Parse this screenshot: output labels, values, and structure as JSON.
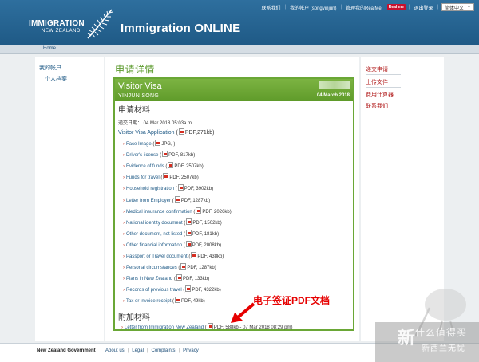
{
  "header": {
    "logo_line1": "IMMIGRATION",
    "logo_line2": "NEW ZEALAND",
    "app_title": "Immigration ONLINE",
    "links": [
      "联系我们",
      "我的帐户 (songyinjun)",
      "管理我的RealMe",
      "退出登录"
    ],
    "realme_badge": "Real me",
    "language": "简体中文"
  },
  "nav": {
    "home": "Home"
  },
  "left_nav": {
    "my_account": "我的帐户",
    "profile": "个人档案"
  },
  "right_nav": [
    "递交申请",
    "上传文件",
    "费用计算器",
    "联系我们"
  ],
  "page_title": "申请详情",
  "visa": {
    "type": "Visitor Visa",
    "applicant": "YINJUN SONG",
    "date": "04 March 2018"
  },
  "materials": {
    "title": "申请材料",
    "submitted": "递交日期： 04 Mar 2018 05:03a.m.",
    "form_link": "Visitor Visa Application",
    "form_info": "PDF,271kb",
    "documents": [
      {
        "name": "Face Image",
        "info": "JPG, "
      },
      {
        "name": "Driver's license",
        "info": "PDF, 817kb"
      },
      {
        "name": "Evidence of funds",
        "info": "PDF, 2507kb"
      },
      {
        "name": "Funds for travel",
        "info": "PDF, 2507kb"
      },
      {
        "name": "Household registration",
        "info": "PDF, 3902kb"
      },
      {
        "name": "Letter from Employer",
        "info": "PDF, 1287kb"
      },
      {
        "name": "Medical insurance confirmation",
        "info": "PDF, 2026kb"
      },
      {
        "name": "National identity document",
        "info": "PDF, 1502kb"
      },
      {
        "name": "Other document, not listed",
        "info": "PDF, 181kb"
      },
      {
        "name": "Other financial information",
        "info": "PDF, 2008kb"
      },
      {
        "name": "Passport or Travel document",
        "info": "PDF, 438kb"
      },
      {
        "name": "Personal circumstances",
        "info": "PDF, 1287kb"
      },
      {
        "name": "Plans in New Zealand",
        "info": "PDF, 133kb"
      },
      {
        "name": "Records of previous travel",
        "info": "PDF, 4322kb"
      },
      {
        "name": "Tax or invoice receipt",
        "info": "PDF, 49kb"
      }
    ]
  },
  "additional": {
    "title": "附加材料",
    "letter": "Letter from Immigration New Zealand",
    "letter_info": "PDF, 588kb - 07 Mar 2018 08:29 pm"
  },
  "annotation": "电子签证PDF文档",
  "footer": {
    "gov": "New Zealand Government",
    "links": [
      "About us",
      "Legal",
      "Complaints",
      "Privacy"
    ]
  },
  "watermark": {
    "line1": "什么值得买",
    "line2": "新西兰无忧",
    "big": "新"
  },
  "colors": {
    "header": "#2466a0",
    "accent_green": "#6aa736",
    "link": "#1f5a86",
    "alert_red": "#e60000"
  }
}
